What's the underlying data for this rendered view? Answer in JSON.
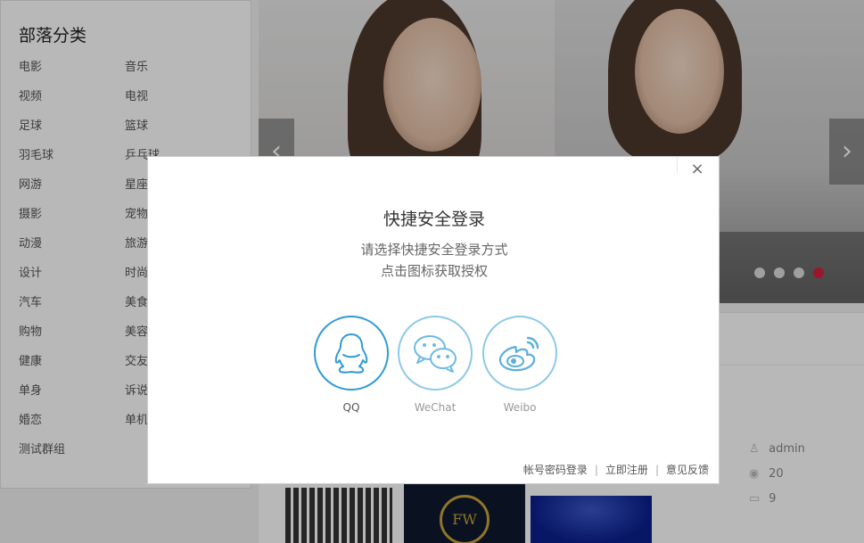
{
  "sidebar": {
    "title": "部落分类",
    "categories": [
      [
        "电影",
        "音乐"
      ],
      [
        "视频",
        "电视"
      ],
      [
        "足球",
        "篮球"
      ],
      [
        "羽毛球",
        "乒乓球"
      ],
      [
        "网游",
        "星座"
      ],
      [
        "摄影",
        "宠物"
      ],
      [
        "动漫",
        "旅游"
      ],
      [
        "设计",
        "时尚"
      ],
      [
        "汽车",
        "美食"
      ],
      [
        "购物",
        "美容"
      ],
      [
        "健康",
        "交友"
      ],
      [
        "单身",
        "诉说"
      ],
      [
        "婚恋",
        "单机"
      ],
      [
        "测试群组",
        ""
      ]
    ]
  },
  "banner": {
    "prev_icon": "‹",
    "next_icon": "›",
    "slide_count": 4,
    "active_slide": 4
  },
  "post_meta": {
    "author": "admin",
    "views": "20",
    "comments": "9",
    "crest_text": "FW"
  },
  "modal": {
    "close_icon": "×",
    "title": "快捷安全登录",
    "subtitle_line1": "请选择快捷安全登录方式",
    "subtitle_line2": "点击图标获取授权",
    "providers": [
      {
        "label": "QQ",
        "icon": "qq-icon"
      },
      {
        "label": "WeChat",
        "icon": "wechat-icon"
      },
      {
        "label": "Weibo",
        "icon": "weibo-icon"
      }
    ],
    "footer": {
      "account_login": "帐号密码登录",
      "register": "立即注册",
      "feedback": "意见反馈",
      "separator": "|"
    }
  },
  "colors": {
    "accent": "#2f9bd6",
    "accent_light": "#8cc9ea",
    "active_dot": "#d6213c"
  }
}
